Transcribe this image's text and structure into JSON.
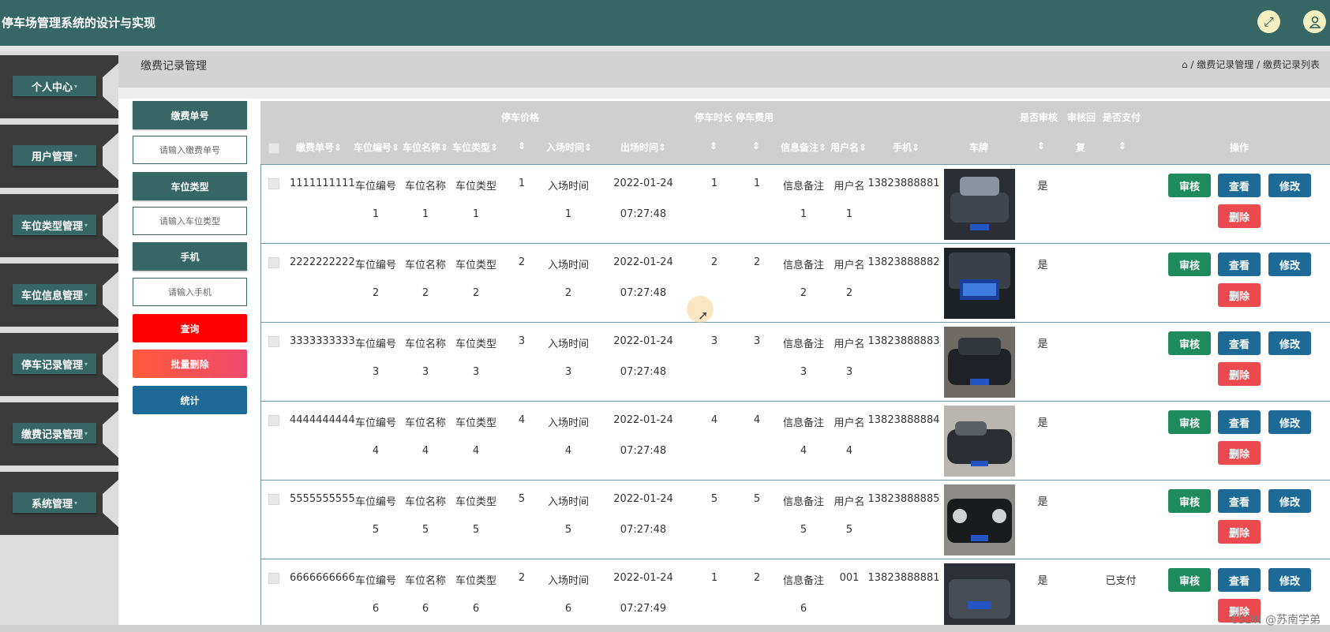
{
  "header": {
    "title": "停车场管理系统的设计与实现",
    "icons": [
      "fullscreen-icon",
      "user-icon"
    ]
  },
  "sidebar": {
    "items": [
      {
        "label": "个人中心"
      },
      {
        "label": "用户管理"
      },
      {
        "label": "车位类型管理"
      },
      {
        "label": "车位信息管理"
      },
      {
        "label": "停车记录管理"
      },
      {
        "label": "缴费记录管理"
      },
      {
        "label": "系统管理"
      }
    ]
  },
  "page": {
    "title": "缴费记录管理",
    "breadcrumb": [
      "缴费记录管理",
      "缴费记录列表"
    ],
    "breadcrumb_sep": "/"
  },
  "search": {
    "fields": [
      {
        "label": "缴费单号",
        "placeholder": "请输入缴费单号"
      },
      {
        "label": "车位类型",
        "placeholder": "请输入车位类型"
      },
      {
        "label": "手机",
        "placeholder": "请输入手机"
      }
    ],
    "query_button": "查询",
    "batch_delete_button": "批量删除",
    "stats_button": "统计"
  },
  "table": {
    "header_top": {
      "price": "停车价格",
      "duration_fee": "停车时长 停车费用",
      "audit": "是否审核",
      "reply": "审核回",
      "paid": "是否支付"
    },
    "columns": {
      "order_no": "缴费单号",
      "slot_no": "车位编号",
      "slot_name": "车位名称",
      "slot_type": "车位类型",
      "price": "",
      "in_time": "入场时间",
      "out_time": "出场时间",
      "duration": "",
      "fee": "",
      "note": "信息备注",
      "username": "用户名",
      "phone": "手机",
      "plate": "车牌",
      "audit": "",
      "reply": "复",
      "paid": "",
      "ops": "操作"
    },
    "rows": [
      {
        "order_no": "1111111111",
        "slot_no": [
          "车位编号",
          "1"
        ],
        "slot_name": [
          "车位名称",
          "1"
        ],
        "slot_type": [
          "车位类型",
          "1"
        ],
        "price": "1",
        "in_time": [
          "入场时间",
          "1"
        ],
        "out_time": [
          "2022-01-24",
          "07:27:48"
        ],
        "duration": "1",
        "fee": "1",
        "note": [
          "信息备注",
          "1"
        ],
        "username": [
          "用户名",
          "1"
        ],
        "phone": "13823888881",
        "audit": "是",
        "paid": ""
      },
      {
        "order_no": "2222222222",
        "slot_no": [
          "车位编号",
          "2"
        ],
        "slot_name": [
          "车位名称",
          "2"
        ],
        "slot_type": [
          "车位类型",
          "2"
        ],
        "price": "2",
        "in_time": [
          "入场时间",
          "2"
        ],
        "out_time": [
          "2022-01-24",
          "07:27:48"
        ],
        "duration": "2",
        "fee": "2",
        "note": [
          "信息备注",
          "2"
        ],
        "username": [
          "用户名",
          "2"
        ],
        "phone": "13823888882",
        "audit": "是",
        "paid": ""
      },
      {
        "order_no": "3333333333",
        "slot_no": [
          "车位编号",
          "3"
        ],
        "slot_name": [
          "车位名称",
          "3"
        ],
        "slot_type": [
          "车位类型",
          "3"
        ],
        "price": "3",
        "in_time": [
          "入场时间",
          "3"
        ],
        "out_time": [
          "2022-01-24",
          "07:27:48"
        ],
        "duration": "3",
        "fee": "3",
        "note": [
          "信息备注",
          "3"
        ],
        "username": [
          "用户名",
          "3"
        ],
        "phone": "13823888883",
        "audit": "是",
        "paid": ""
      },
      {
        "order_no": "4444444444",
        "slot_no": [
          "车位编号",
          "4"
        ],
        "slot_name": [
          "车位名称",
          "4"
        ],
        "slot_type": [
          "车位类型",
          "4"
        ],
        "price": "4",
        "in_time": [
          "入场时间",
          "4"
        ],
        "out_time": [
          "2022-01-24",
          "07:27:48"
        ],
        "duration": "4",
        "fee": "4",
        "note": [
          "信息备注",
          "4"
        ],
        "username": [
          "用户名",
          "4"
        ],
        "phone": "13823888884",
        "audit": "是",
        "paid": ""
      },
      {
        "order_no": "5555555555",
        "slot_no": [
          "车位编号",
          "5"
        ],
        "slot_name": [
          "车位名称",
          "5"
        ],
        "slot_type": [
          "车位类型",
          "5"
        ],
        "price": "5",
        "in_time": [
          "入场时间",
          "5"
        ],
        "out_time": [
          "2022-01-24",
          "07:27:48"
        ],
        "duration": "5",
        "fee": "5",
        "note": [
          "信息备注",
          "5"
        ],
        "username": [
          "用户名",
          "5"
        ],
        "phone": "13823888885",
        "audit": "是",
        "paid": ""
      },
      {
        "order_no": "6666666666",
        "slot_no": [
          "车位编号",
          "6"
        ],
        "slot_name": [
          "车位名称",
          "6"
        ],
        "slot_type": [
          "车位类型",
          "6"
        ],
        "price": "2",
        "in_time": [
          "入场时间",
          "6"
        ],
        "out_time": [
          "2022-01-24",
          "07:27:49"
        ],
        "duration": "1",
        "fee": "2",
        "note": [
          "信息备注",
          "6"
        ],
        "username": [
          "001",
          ""
        ],
        "phone": "13823888881",
        "audit": "是",
        "paid": "已支付"
      }
    ],
    "row_buttons": {
      "approve": "审核",
      "view": "查看",
      "edit": "修改",
      "delete": "删除"
    }
  },
  "watermark": "CSDN @苏南学弟",
  "colors": {
    "primary": "#376765",
    "approve": "#1f8a5e",
    "blue": "#1e6a97",
    "danger": "#ec4a4e",
    "query": "#ff0000"
  }
}
